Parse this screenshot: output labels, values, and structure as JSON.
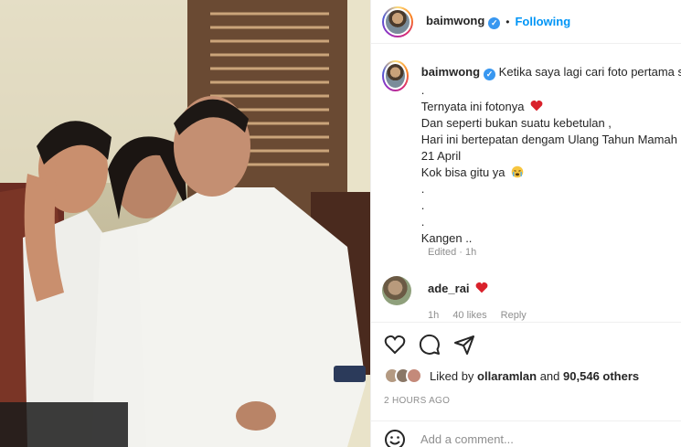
{
  "post": {
    "username": "baimwong",
    "verified_mark": "✓",
    "dot": "•",
    "follow_status": "Following"
  },
  "caption": {
    "first_line": "Ketika saya lagi cari foto pertama s",
    "lines": [
      ".",
      "Ternyata ini fotonya",
      "Dan seperti bukan suatu kebetulan ,",
      "Hari ini bertepatan dengam Ulang Tahun Mamah",
      "21 April",
      "Kok bisa gitu ya",
      ".",
      ".",
      ".",
      "Kangen .."
    ],
    "edited": "Edited · 1h"
  },
  "comment": {
    "username": "ade_rai",
    "time": "1h",
    "likes": "40 likes",
    "reply": "Reply"
  },
  "likes": {
    "prefix": "Liked by",
    "user": "ollaramlan",
    "and": "and",
    "count": "90,546 others"
  },
  "timestamp": "2 HOURS AGO",
  "add_comment": {
    "placeholder": "Add a comment..."
  },
  "icons": [
    "heart-icon",
    "comment-icon",
    "share-icon",
    "emoji-icon",
    "red-heart-emoji",
    "crying-emoji"
  ],
  "colors": {
    "link": "#0095f6",
    "verified": "#3897f0",
    "muted": "#8e8e8e",
    "text": "#262626"
  }
}
